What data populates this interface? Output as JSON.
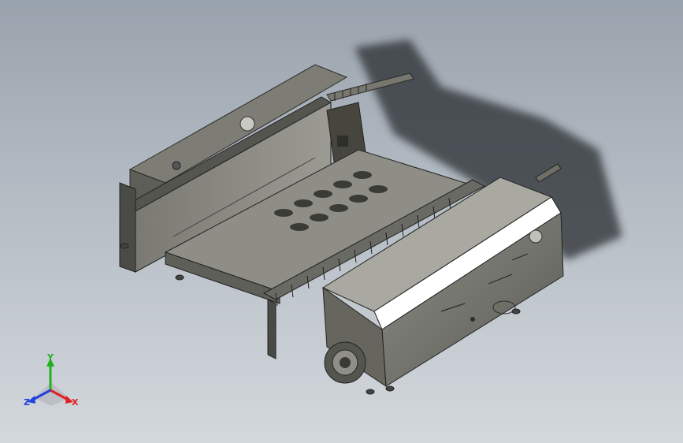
{
  "viewport": {
    "background_top": "#9aa3ad",
    "background_bottom": "#d3d8dc"
  },
  "model": {
    "body_color": "#8a8a82",
    "dark_color": "#3a3a36",
    "highlight_color": "#ffffff"
  },
  "triad": {
    "x_label": "X",
    "y_label": "Y",
    "z_label": "Z",
    "x_color": "#e02020",
    "y_color": "#20b020",
    "z_color": "#2040e0"
  }
}
